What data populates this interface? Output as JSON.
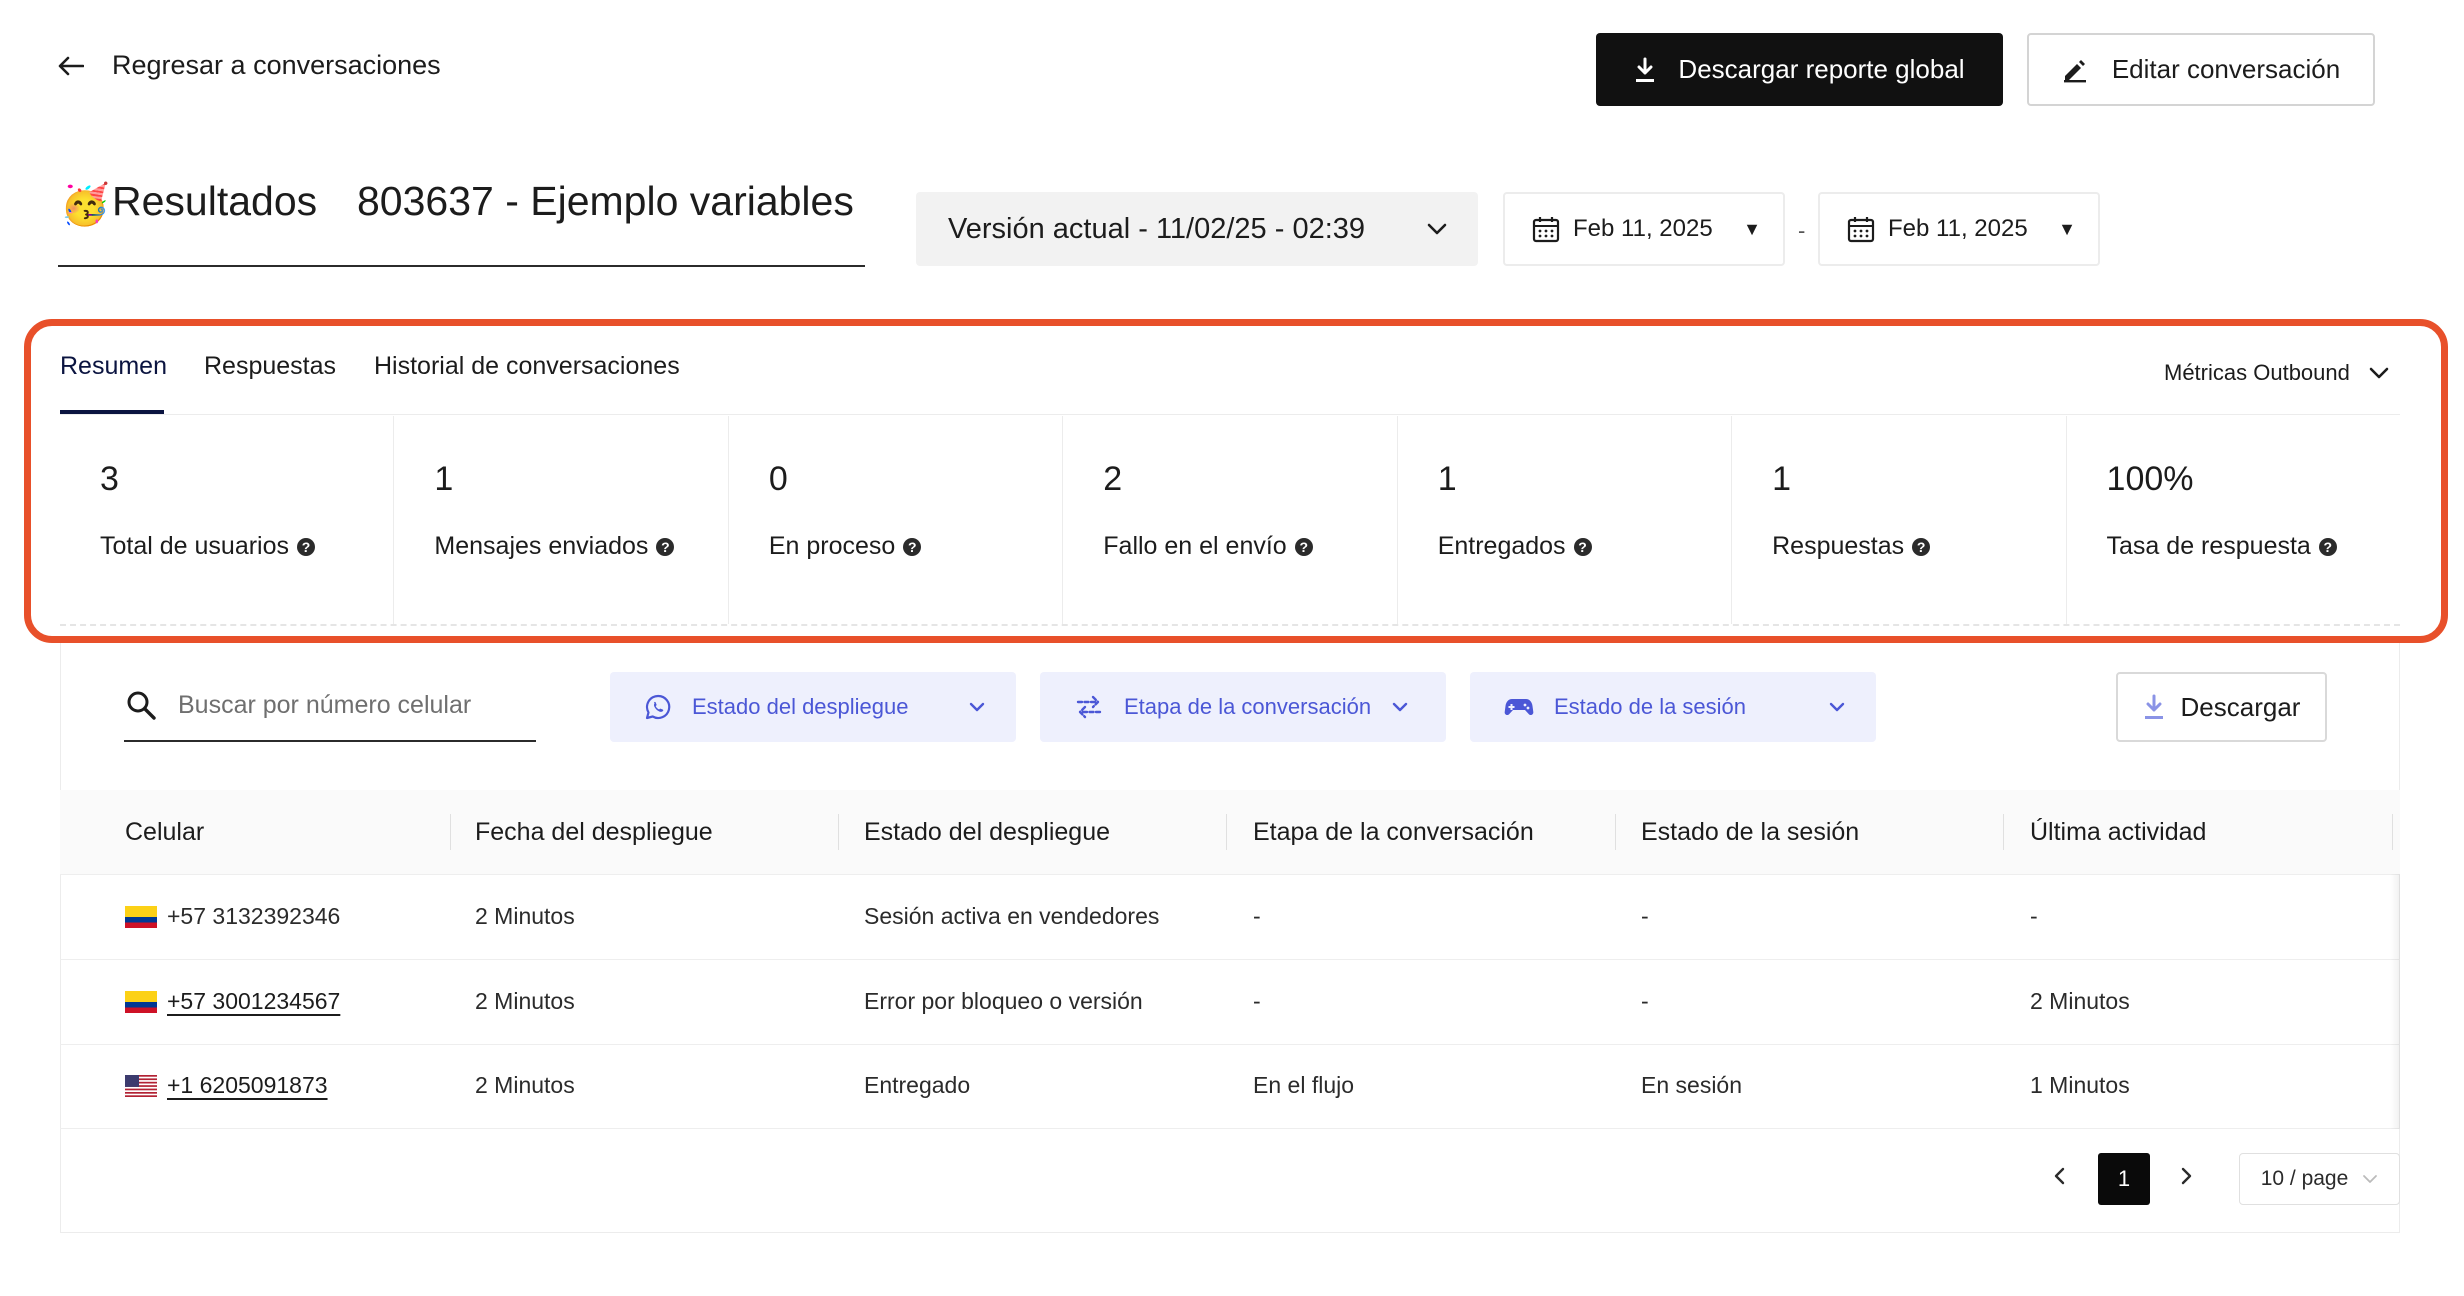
{
  "header": {
    "back_label": "Regresar a conversaciones",
    "download_global_label": "Descargar reporte global",
    "edit_label": "Editar conversación"
  },
  "title": {
    "emoji": "🥳",
    "label": "Resultados",
    "name": "803637 - Ejemplo variables"
  },
  "version_select": {
    "value": "Versión actual - 11/02/25 - 02:39"
  },
  "date_range": {
    "start": "Feb 11, 2025",
    "end": "Feb 11, 2025",
    "separator": "-"
  },
  "tabs": [
    {
      "label": "Resumen",
      "active": true
    },
    {
      "label": "Respuestas",
      "active": false
    },
    {
      "label": "Historial de conversaciones",
      "active": false
    }
  ],
  "metrics_select": {
    "label": "Métricas Outbound"
  },
  "metrics": [
    {
      "value": "3",
      "label": "Total de usuarios"
    },
    {
      "value": "1",
      "label": "Mensajes enviados"
    },
    {
      "value": "0",
      "label": "En proceso"
    },
    {
      "value": "2",
      "label": "Fallo en el envío"
    },
    {
      "value": "1",
      "label": "Entregados"
    },
    {
      "value": "1",
      "label": "Respuestas"
    },
    {
      "value": "100%",
      "label": "Tasa de respuesta"
    }
  ],
  "toolbar": {
    "search_placeholder": "Buscar por número celular",
    "filters": [
      "Estado del despliegue",
      "Etapa de la conversación",
      "Estado de la sesión"
    ],
    "download_label": "Descargar"
  },
  "table": {
    "columns": [
      "Celular",
      "Fecha del despliegue",
      "Estado del despliegue",
      "Etapa de la conversación",
      "Estado de la sesión",
      "Última actividad"
    ],
    "rows": [
      {
        "flag": "colombia-flag",
        "phone": "+57 3132392346",
        "linked": false,
        "date": "2 Minutos",
        "deploy_status": "Sesión activa en vendedores",
        "stage": "-",
        "session": "-",
        "last_activity": "-"
      },
      {
        "flag": "colombia-flag",
        "phone": "+57 3001234567",
        "linked": true,
        "date": "2 Minutos",
        "deploy_status": "Error por bloqueo o versión",
        "stage": "-",
        "session": "-",
        "last_activity": "2 Minutos"
      },
      {
        "flag": "usa-flag",
        "phone": "+1 6205091873",
        "linked": true,
        "date": "2 Minutos",
        "deploy_status": "Entregado",
        "stage": "En el flujo",
        "session": "En sesión",
        "last_activity": "1 Minutos"
      }
    ]
  },
  "pagination": {
    "current": "1",
    "page_size": "10 / page"
  },
  "colors": {
    "highlight": "#e8502a",
    "filter_bg": "#eef0fd",
    "filter_text": "#4b57d6",
    "tab_active": "#0b1440"
  }
}
